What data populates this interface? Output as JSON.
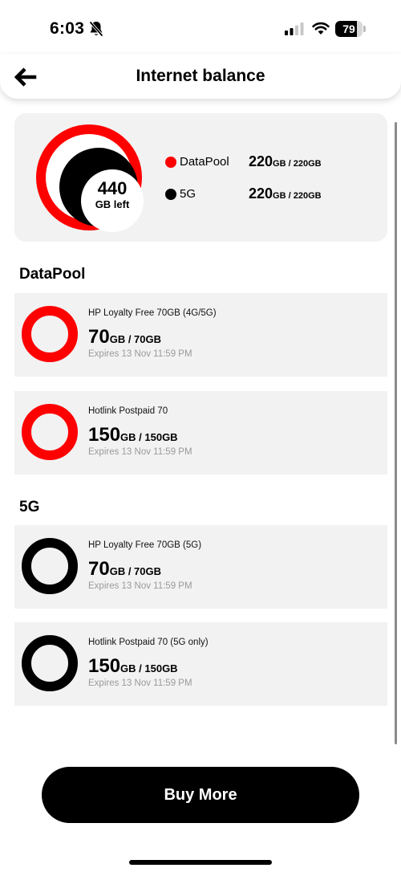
{
  "status_bar": {
    "time": "6:03",
    "battery": "79",
    "battery_level": 0.79
  },
  "header": {
    "title": "Internet balance",
    "back_icon": "arrow-left-icon"
  },
  "summary": {
    "total_value": "440",
    "total_label": "GB left",
    "legend": [
      {
        "name": "DataPool",
        "amount": "220",
        "total": "GB / 220GB",
        "color": "#ff0000"
      },
      {
        "name": "5G",
        "amount": "220",
        "total": "GB / 220GB",
        "color": "#000000"
      }
    ]
  },
  "sections": [
    {
      "title": "DataPool",
      "ring_color": "#ff0000",
      "plans": [
        {
          "name": "HP Loyalty Free 70GB (4G/5G)",
          "amount": "70",
          "total": "GB / 70GB",
          "expiry": "Expires 13 Nov 11:59 PM"
        },
        {
          "name": "Hotlink Postpaid 70",
          "amount": "150",
          "total": "GB / 150GB",
          "expiry": "Expires 13 Nov 11:59 PM"
        }
      ]
    },
    {
      "title": "5G",
      "ring_color": "#000000",
      "plans": [
        {
          "name": "HP Loyalty Free 70GB (5G)",
          "amount": "70",
          "total": "GB / 70GB",
          "expiry": "Expires 13 Nov 11:59 PM"
        },
        {
          "name": "Hotlink Postpaid 70 (5G only)",
          "amount": "150",
          "total": "GB / 150GB",
          "expiry": "Expires 13 Nov 11:59 PM"
        }
      ]
    }
  ],
  "buy_button": {
    "label": "Buy More"
  }
}
